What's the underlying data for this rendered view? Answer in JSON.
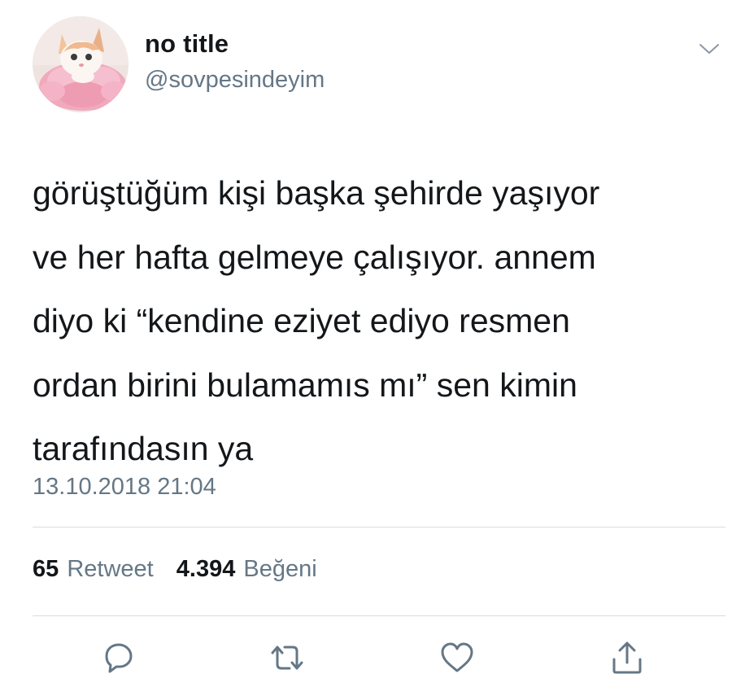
{
  "user": {
    "display_name": "no title",
    "handle": "@sovpesindeyim",
    "avatar_icon": "cat-with-pink-tutu-avatar"
  },
  "menu_icon": "chevron-down-icon",
  "tweet": {
    "lines": [
      "görüştüğüm kişi başka şehirde yaşıyor",
      "ve her hafta gelmeye çalışıyor. annem",
      "diyo ki “kendine eziyet ediyo resmen",
      "ordan birini bulamamıs mı” sen kimin",
      "tarafındasın ya"
    ],
    "timestamp": "13.10.2018 21:04"
  },
  "stats": {
    "retweets_count": "65",
    "retweets_label": "Retweet",
    "likes_count": "4.394",
    "likes_label": "Beğeni"
  },
  "actions": [
    {
      "name": "reply",
      "icon": "reply-bubble-icon"
    },
    {
      "name": "retweet",
      "icon": "retweet-arrows-icon"
    },
    {
      "name": "like",
      "icon": "heart-icon"
    },
    {
      "name": "share",
      "icon": "share-upload-icon"
    }
  ],
  "colors": {
    "text_primary": "#14171a",
    "text_secondary": "#657786",
    "divider": "#d6dde3",
    "icon": "#657786"
  }
}
